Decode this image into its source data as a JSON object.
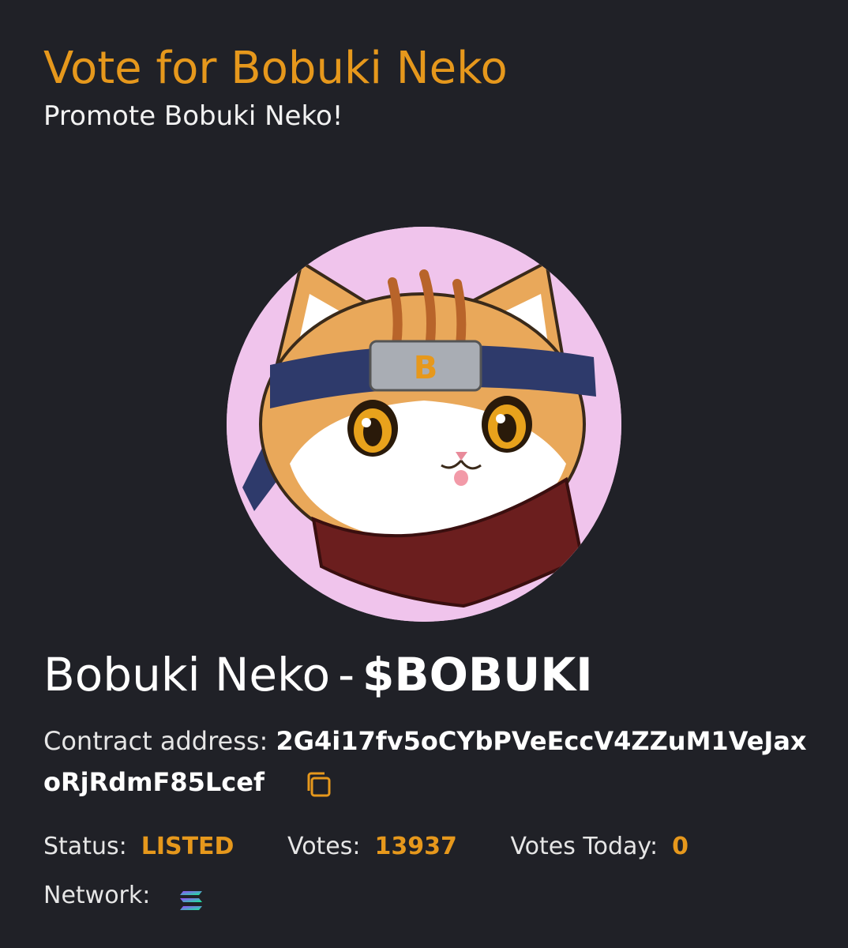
{
  "header": {
    "title": "Vote for Bobuki Neko",
    "subtitle": "Promote Bobuki Neko!"
  },
  "token": {
    "name": "Bobuki Neko",
    "separator": "-",
    "symbol": "$BOBUKI",
    "avatar_icon": "cat-ninja-avatar"
  },
  "contract": {
    "label": "Contract address:",
    "address": "2G4i17fv5oCYbPVeEccV4ZZuM1VeJaxoRjRdmF85Lcef",
    "copy_icon": "copy-icon"
  },
  "stats": {
    "status_label": "Status:",
    "status_value": "LISTED",
    "votes_label": "Votes:",
    "votes_value": "13937",
    "votes_today_label": "Votes Today:",
    "votes_today_value": "0"
  },
  "network": {
    "label": "Network:",
    "icon": "solana-icon"
  },
  "colors": {
    "background": "#202127",
    "accent": "#e6981c",
    "avatar_background": "#f0c4ec"
  }
}
